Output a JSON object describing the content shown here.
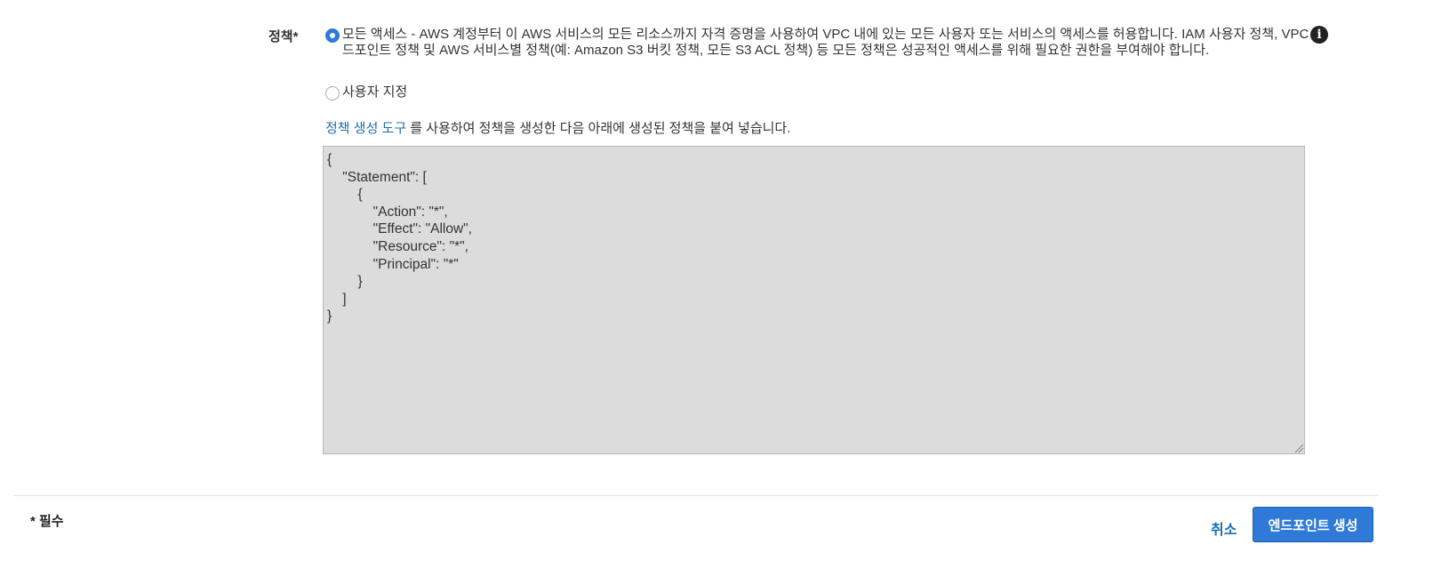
{
  "form": {
    "policy_label": "정책*",
    "policy_options": [
      {
        "label": "모든 액세스 - AWS 계정부터 이 AWS 서비스의 모든 리소스까지 자격 증명을 사용하여 VPC 내에 있는 모든 사용자 또는 서비스의 액세스를 허용합니다. IAM 사용자 정책, VPC 엔드포인트 정책 및 AWS 서비스별 정책(예: Amazon S3 버킷 정책, 모든 S3 ACL 정책) 등 모든 정책은 성공적인 액세스를 위해 필요한 권한을 부여해야 합니다.",
        "selected": true
      },
      {
        "label": "사용자 지정",
        "selected": false
      }
    ],
    "info_icon": "info-circle-icon",
    "helper_link": "정책 생성 도구",
    "helper_text": " 를 사용하여 정책을 생성한 다음 아래에 생성된 정책을 붙여 넣습니다.",
    "policy_json": "{\n    \"Statement\": [\n        {\n            \"Action\": \"*\",\n            \"Effect\": \"Allow\",\n            \"Resource\": \"*\",\n            \"Principal\": \"*\"\n        }\n    ]\n}"
  },
  "footer": {
    "required_note": "* 필수",
    "cancel_label": "취소",
    "create_label": "엔드포인트 생성"
  },
  "colors": {
    "accent": "#2f7ad6",
    "link": "#1f6fb2",
    "editor_background": "#dcdcdc"
  }
}
